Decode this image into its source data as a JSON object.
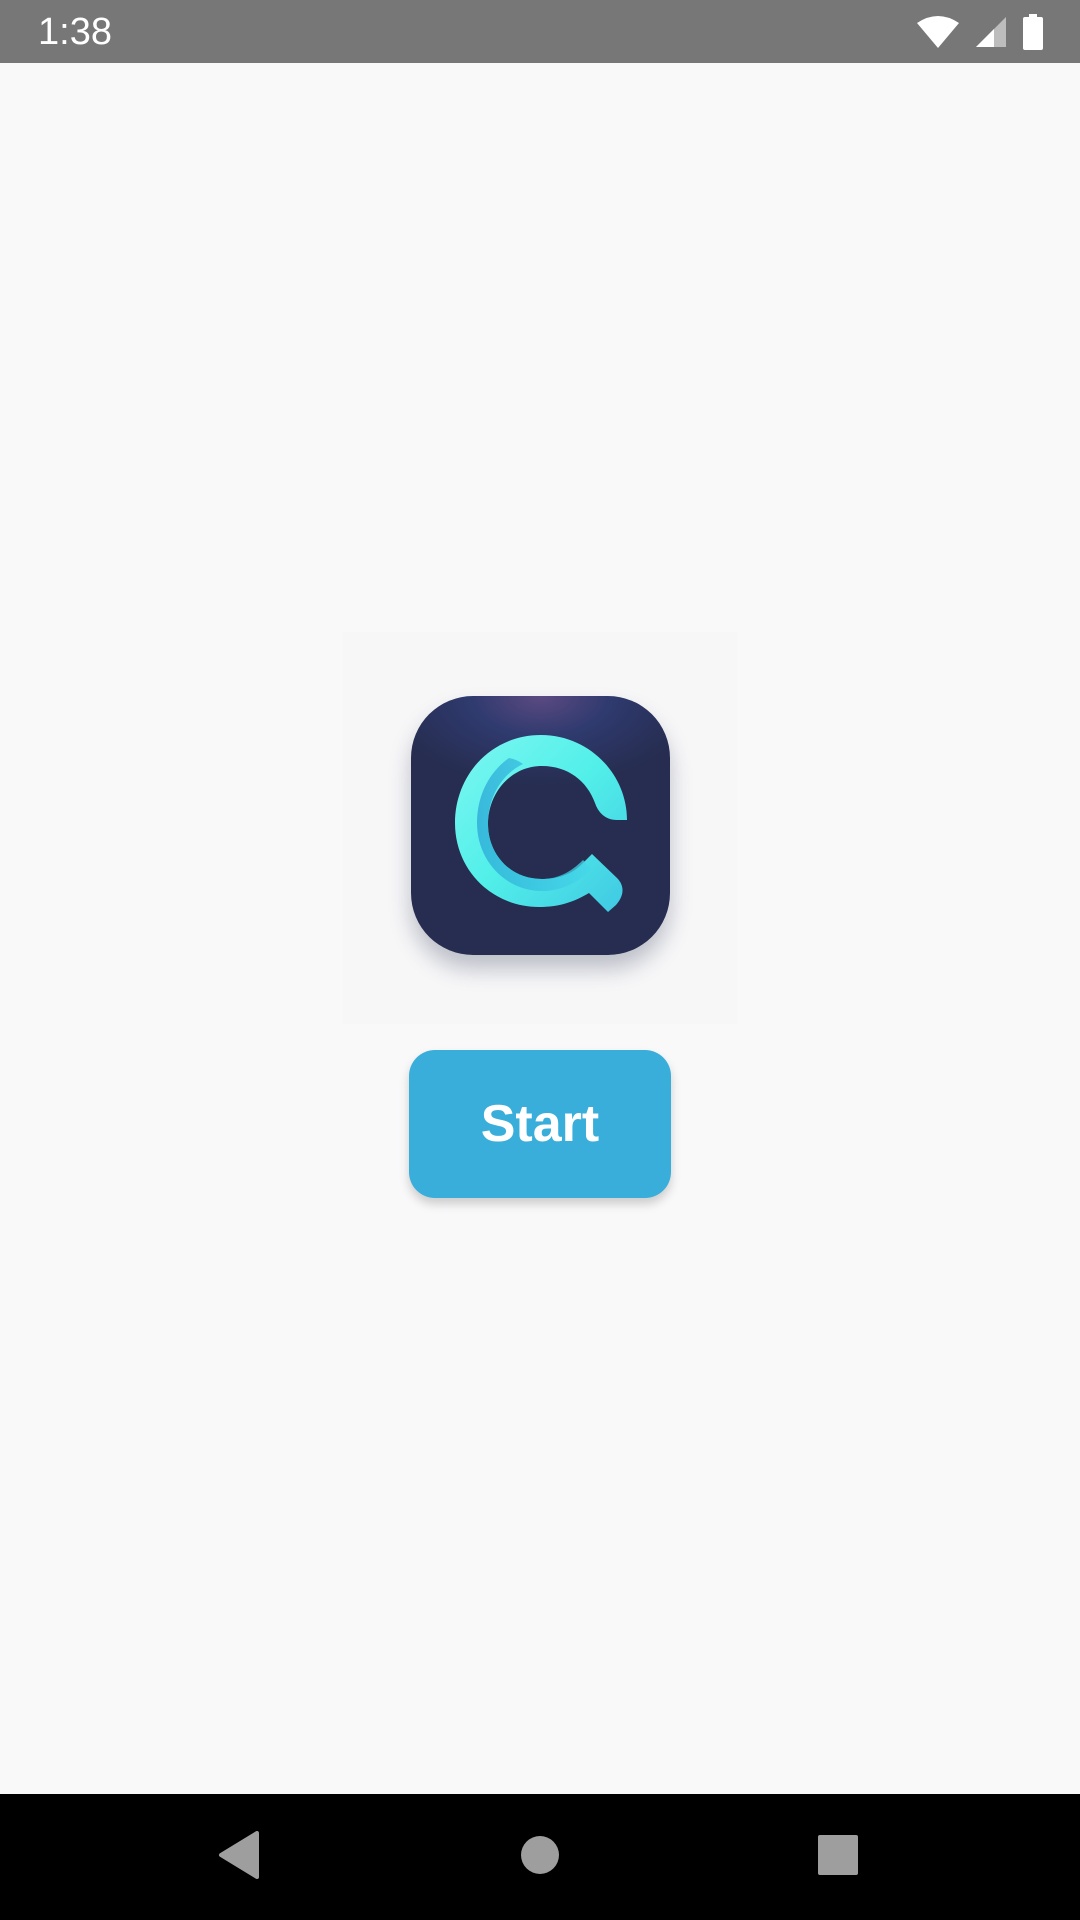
{
  "status_bar": {
    "time": "1:38",
    "icons": [
      "wifi-icon",
      "cellular-signal-icon",
      "battery-icon"
    ]
  },
  "logo": {
    "icon": "app-logo-q-icon",
    "tile_color": "#262d50",
    "accent_color": "#52efe9"
  },
  "main": {
    "start_label": "Start",
    "button_color": "#3aaedb"
  },
  "nav_bar": {
    "icons": [
      "back-icon",
      "home-icon",
      "recents-icon"
    ]
  }
}
